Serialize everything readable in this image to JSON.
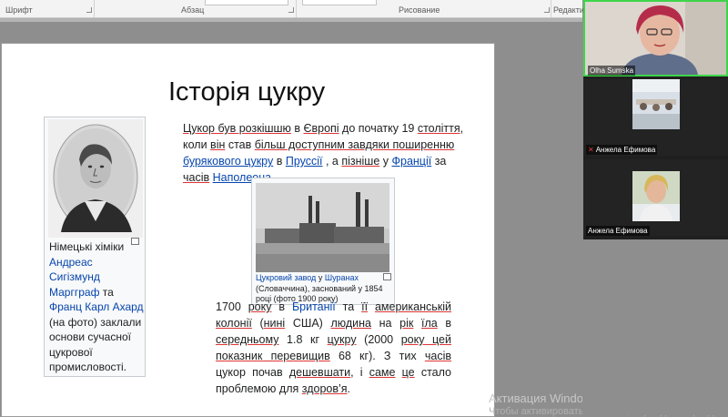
{
  "ribbon": {
    "groups": [
      "Шрифт",
      "Абзац",
      "Рисование",
      "Редактир"
    ]
  },
  "slide": {
    "title": "Історія цукру",
    "infobox_text": {
      "pre": "Німецькі хіміки ",
      "link1": "Андреас Сигізмунд Маргграф",
      "mid": " та ",
      "link2": "Франц Карл Ахард",
      "post": " (на фото) заклали основи сучасної цукрової промисловості."
    },
    "para1": {
      "s1": "Цукор був розкішшю",
      "s2": " в ",
      "s3": "Європі",
      "s4": " до початку 19 ",
      "s5": "століття",
      "s6": ", коли ",
      "s7": "він",
      "s8": " став ",
      "s9": "більш доступним завдяки поширенню",
      "s10": " ",
      "s11": "бурякового цукру",
      "s12": " в ",
      "s13": "Пруссії",
      "s14": " , а ",
      "s15": "пізніше",
      "s16": " у ",
      "s17": "Франції",
      "s18": " за ",
      "s19": "часів",
      "s20": " ",
      "s21": "Наполеона",
      "s22": " ."
    },
    "factory_caption": {
      "link1": "Цукровий завод",
      "mid": " у ",
      "link2": "Шуранах",
      "rest": " (Словаччина), заснований у 1854 році (фото 1900 року)"
    },
    "para2": {
      "t1": "1700 ",
      "t2": "року",
      "t3": " в ",
      "t4": "Британії",
      "t5": " та ",
      "t6": "її",
      "t7": " ",
      "t8": "американській колонії",
      "t9": " (",
      "t10": "нині",
      "t11": " США) ",
      "t12": "людина",
      "t13": " на ",
      "t14": "рік",
      "t15": " ",
      "t16": "їла",
      "t17": " в ",
      "t18": "середньому",
      "t19": " 1.8 кг ",
      "t20": "цукру",
      "t21": " (2000 ",
      "t22": "року цей показник перевищив",
      "t23": " 68 кг). З тих ",
      "t24": "часів",
      "t25": " цукор почав ",
      "t26": "дешевшати",
      "t27": ", і ",
      "t28": "саме",
      "t29": " ",
      "t30": "це",
      "t31": " стало проблемою для ",
      "t32": "здоров’я",
      "t33": "."
    }
  },
  "watermark": {
    "line1": "Активация Windows",
    "line2": "Чтобы активировать Windows, перейдите в раздел"
  },
  "participants": [
    {
      "name": "Olha Sumska",
      "muted": false,
      "active": true
    },
    {
      "name": "Анжела Ефимова",
      "muted": true,
      "active": false
    },
    {
      "name": "Анжела Ефимова",
      "muted": false,
      "active": false
    }
  ],
  "colors": {
    "active_speaker": "#3fd54a",
    "link": "#0645ad",
    "spell_underline": "#d33"
  }
}
